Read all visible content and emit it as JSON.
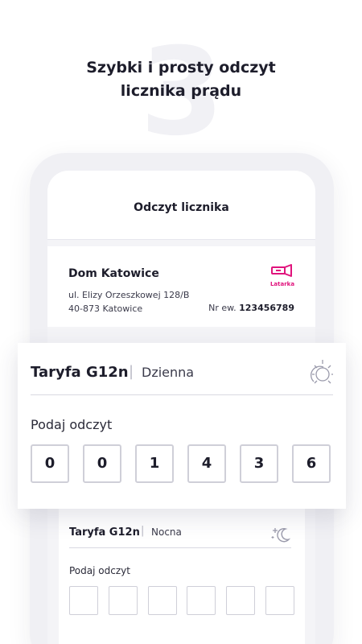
{
  "background_digit": "3",
  "headline": {
    "line1": "Szybki i prosty odczyt",
    "line2": "licznika prądu"
  },
  "screen": {
    "title": "Odczyt licznika"
  },
  "address_card": {
    "place_name": "Dom Katowice",
    "address_line1": "ul. Elizy Orzeszkowej 128/B",
    "address_line2": "40-873 Katowice",
    "flashlight_label": "Latarka",
    "flashlight_icon": "flashlight-icon",
    "meter_number_label": "Nr ew.",
    "meter_number": "123456789"
  },
  "day_tariff": {
    "name": "Taryfa G12n",
    "mode": "Dzienna",
    "icon": "sun-icon",
    "prompt": "Podaj odczyt",
    "digits": [
      "0",
      "0",
      "1",
      "4",
      "3",
      "6"
    ]
  },
  "night_tariff": {
    "name": "Taryfa G12n",
    "mode": "Nocna",
    "icon": "moon-stars-icon",
    "prompt": "Podaj odczyt",
    "digits": [
      "",
      "",
      "",
      "",
      "",
      ""
    ]
  },
  "colors": {
    "accent": "#e0137c",
    "text": "#1d1d2b",
    "border": "#cfcfd8"
  }
}
